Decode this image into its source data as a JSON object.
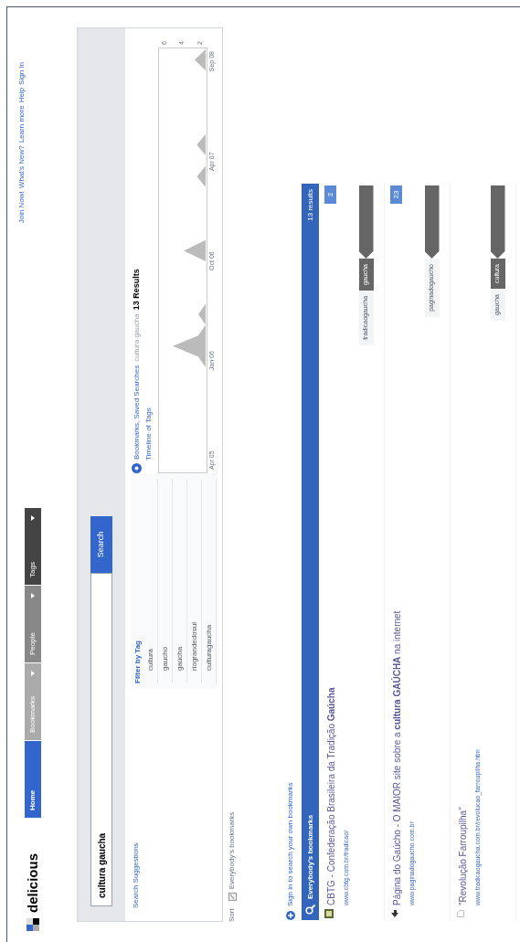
{
  "header": {
    "logo": "delicious",
    "nav_tabs": [
      {
        "label": "Home",
        "selected": true,
        "has_menu": false
      },
      {
        "label": "Bookmarks",
        "selected": false,
        "has_menu": true
      },
      {
        "label": "People",
        "selected": false,
        "has_menu": true
      },
      {
        "label": "Tags",
        "selected": false,
        "has_menu": true
      }
    ],
    "top_links": [
      "Join Now!",
      "What's New?",
      "Learn more",
      "Help",
      "Sign In"
    ]
  },
  "search": {
    "value": "cultura gaucha",
    "button": "Search"
  },
  "suggestions_link": "Search Suggestions",
  "tag_filter": {
    "title": "Filter by Tag",
    "tags": [
      "cultura",
      "gaucho",
      "gaúcha",
      "riograndedosul",
      "culturagaucha"
    ]
  },
  "results_summary": {
    "link": "Bookmarks, Saved Searches",
    "query": "cultura gaucha",
    "count": "13 Results",
    "timeline_link": "Timeline of Tags"
  },
  "timeline": {
    "date_labels": [
      "Apr 05",
      "Jan 06",
      "Oct 06",
      "Apr 07",
      "Sep 08"
    ],
    "count_labels": [
      "6",
      "4",
      "2"
    ]
  },
  "view_options": {
    "label": "Sort",
    "option": "Everybody's bookmarks"
  },
  "sign_in_prompt": "Sign in to search your own bookmarks",
  "results_bar": {
    "title": "Everybody's bookmarks",
    "count": "13 results"
  },
  "bookmarks": [
    {
      "kind": "favicon",
      "title": "CBTG - Confederação Brasileira da Tradição **Gaúcha**",
      "url": "www.cbtg.com.br/tradicao/",
      "saves": "2",
      "tags": [
        {
          "label": "tradicaogaucha",
          "selected": false
        },
        {
          "label": "gaucha",
          "selected": true
        }
      ]
    },
    {
      "kind": "arrow",
      "title": "Página do Gaúcho - O MAIOR site sobre a **cultura GAÚCHA** na internet",
      "url": "www.paginadogaucho.com.br",
      "saves": "23",
      "tags": [
        {
          "label": "paginadogaucho",
          "selected": false
        }
      ]
    },
    {
      "kind": "page",
      "title": "\"Revolução Farroupilha\"",
      "url": "www.tradicaogaucha.com.br/revolucao_farroupilha.htm",
      "tags": [
        {
          "label": "gaucha",
          "selected": false
        },
        {
          "label": "cultura",
          "selected": true
        }
      ]
    }
  ]
}
